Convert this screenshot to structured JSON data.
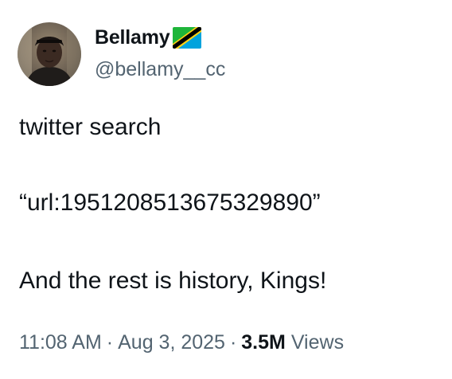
{
  "author": {
    "display_name": "Bellamy",
    "handle": "@bellamy__cc",
    "flag_icon": "tanzania-flag-icon"
  },
  "tweet": {
    "lines": [
      "twitter search",
      "“url:1951208513675329890”",
      "And the rest is history, Kings!"
    ]
  },
  "meta": {
    "time": "11:08 AM",
    "separator": "·",
    "date": "Aug 3, 2025",
    "views_count": "3.5M",
    "views_label": "Views"
  },
  "colors": {
    "text_primary": "#0f1419",
    "text_secondary": "#536471"
  }
}
